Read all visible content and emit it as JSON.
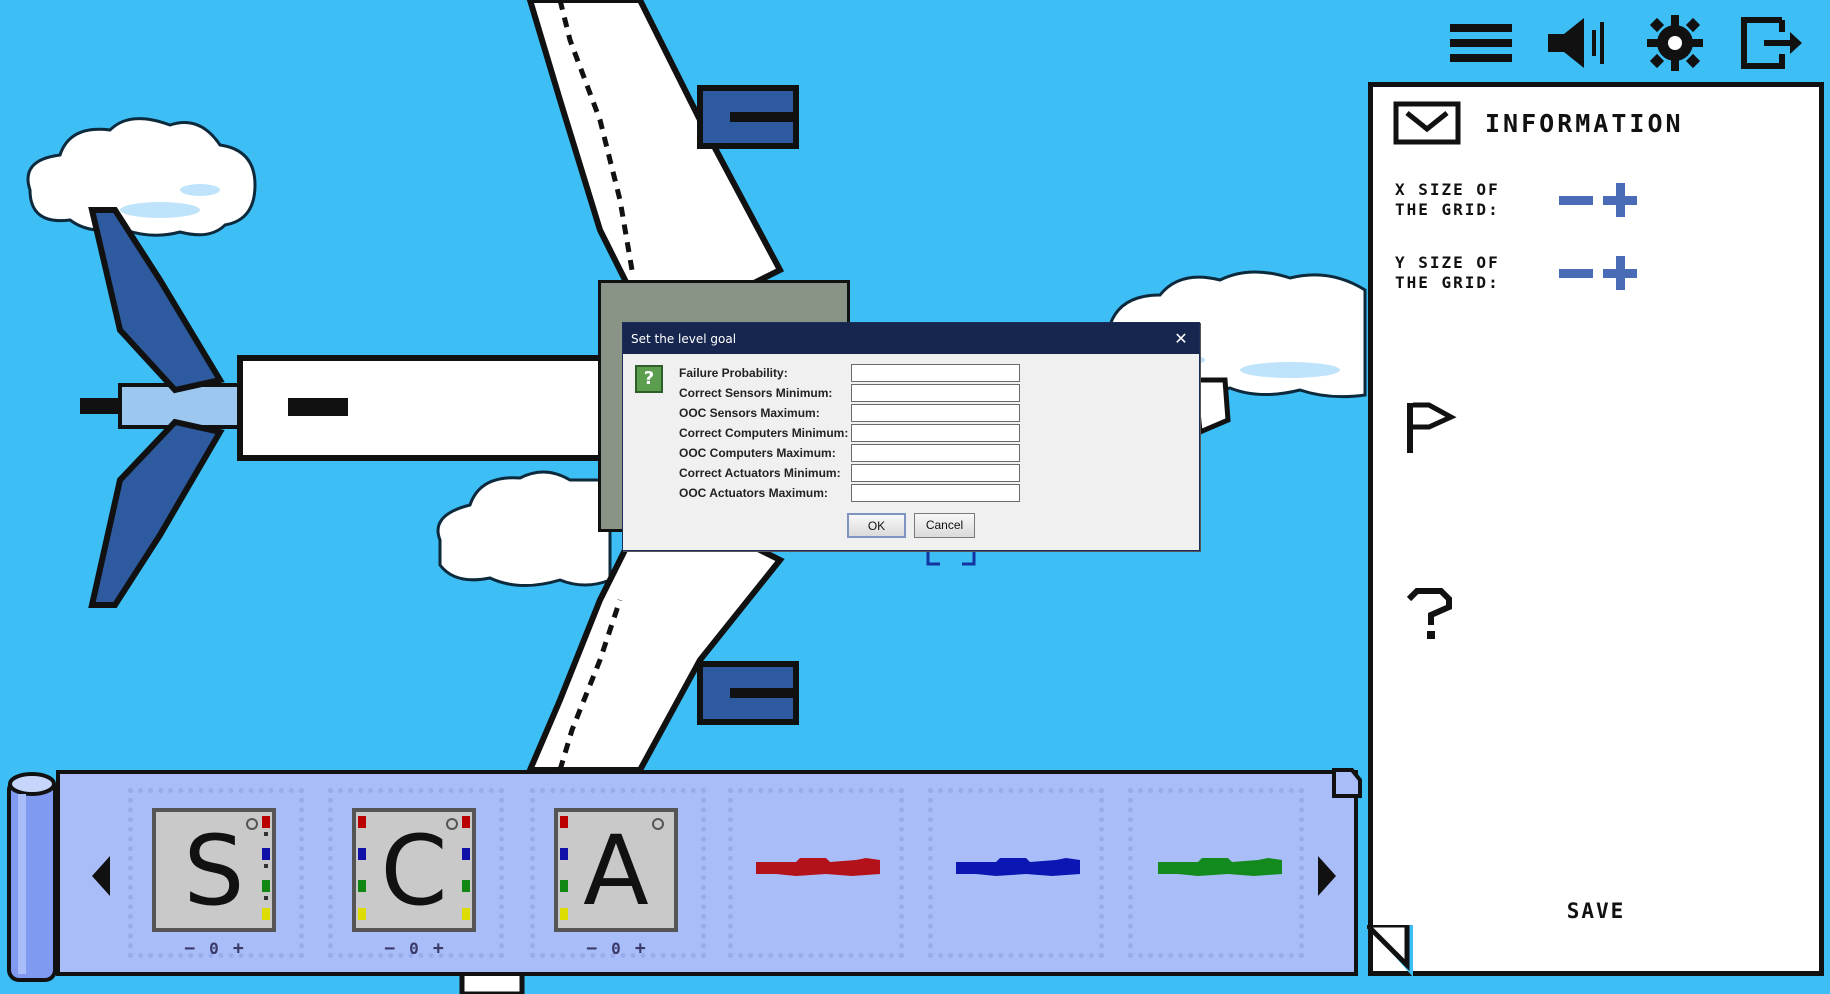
{
  "toolbar": {
    "icons": [
      "menu-icon",
      "speaker-icon",
      "gear-icon",
      "exit-icon"
    ]
  },
  "info_panel": {
    "title": "INFORMATION",
    "x_grid_label": "X SIZE OF\nTHE GRID:",
    "y_grid_label": "Y SIZE OF\nTHE GRID:",
    "save_label": "SAVE"
  },
  "tray": {
    "components": [
      {
        "letter": "S",
        "count": "0"
      },
      {
        "letter": "C",
        "count": "0"
      },
      {
        "letter": "A",
        "count": "0"
      }
    ],
    "wires": [
      {
        "color": "#b3121a"
      },
      {
        "color": "#0b16b3"
      },
      {
        "color": "#128a1e"
      }
    ],
    "minus": "−",
    "plus": "+"
  },
  "dialog": {
    "title": "Set the level goal",
    "close": "✕",
    "fields": [
      {
        "label": "Failure Probability:",
        "value": ""
      },
      {
        "label": "Correct Sensors Minimum:",
        "value": ""
      },
      {
        "label": "OOC Sensors Maximum:",
        "value": ""
      },
      {
        "label": "Correct Computers Minimum:",
        "value": ""
      },
      {
        "label": "OOC Computers Maximum:",
        "value": ""
      },
      {
        "label": "Correct Actuators Minimum:",
        "value": ""
      },
      {
        "label": "OOC Actuators Maximum:",
        "value": ""
      }
    ],
    "ok_label": "OK",
    "cancel_label": "Cancel"
  },
  "colors": {
    "sky": "#3dbef5",
    "plane_blue": "#2e5aa0",
    "tray_bg": "#a9bdf8",
    "dialog_title_bar": "#17264f"
  }
}
